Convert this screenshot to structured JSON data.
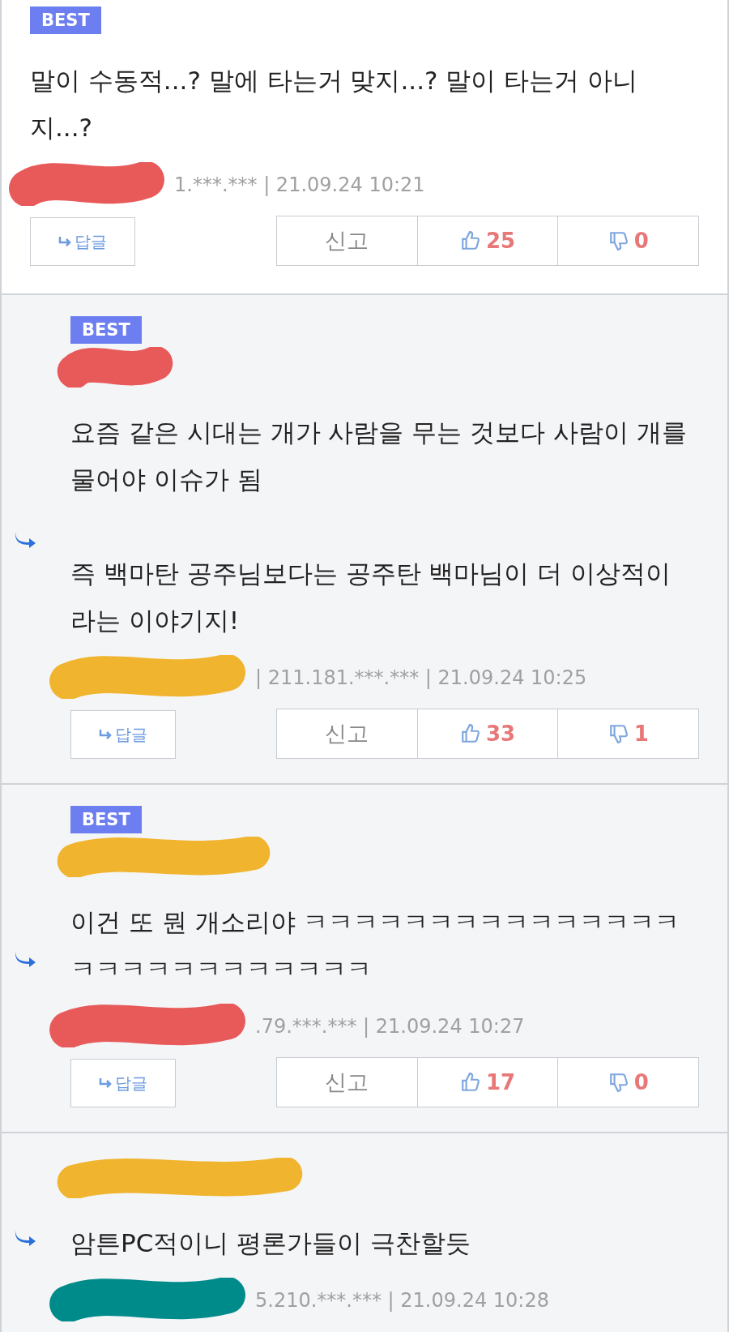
{
  "comments": [
    {
      "kind": "comment",
      "badge": "BEST",
      "paragraphs": [
        "말이 수동적...? 말에 타는거 맞지...? 말이 타는거 아니지...?"
      ],
      "meta": "1.***.*** | 21.09.24 10:21",
      "meta_redaction": {
        "color": "#e85a5a"
      },
      "reply_label": "답글",
      "report_label": "신고",
      "likes": "25",
      "dislikes": "0"
    },
    {
      "kind": "reply",
      "badge": "BEST",
      "name_redaction": {
        "color": "#e85a5a"
      },
      "paragraphs": [
        "요즘 같은 시대는 개가 사람을 무는 것보다 사람이 개를 물어야 이슈가 됨",
        "즉 백마탄 공주님보다는 공주탄 백마님이 더 이상적이라는 이야기지!"
      ],
      "meta": "| 211.181.***.*** | 21.09.24 10:25",
      "meta_redaction": {
        "color": "#f0b42e"
      },
      "reply_label": "답글",
      "report_label": "신고",
      "likes": "33",
      "dislikes": "1"
    },
    {
      "kind": "reply",
      "badge": "BEST",
      "name_redaction": {
        "color": "#f0b42e"
      },
      "paragraphs": [
        "이건 또 뭔 개소리야 ㅋㅋㅋㅋㅋㅋㅋㅋㅋㅋㅋㅋㅋㅋㅋㅋㅋㅋㅋㅋㅋㅋㅋㅋㅋㅋㅋ"
      ],
      "meta": ".79.***.*** | 21.09.24 10:27",
      "meta_redaction": {
        "color": "#e85a5a"
      },
      "reply_label": "답글",
      "report_label": "신고",
      "likes": "17",
      "dislikes": "0"
    },
    {
      "kind": "reply",
      "name_redaction": {
        "color": "#f0b42e"
      },
      "paragraphs": [
        "암튼PC적이니 평론가들이 극찬할듯"
      ],
      "meta": "5.210.***.*** | 21.09.24 10:28",
      "meta_redaction": {
        "color": "#008b8b"
      }
    }
  ]
}
